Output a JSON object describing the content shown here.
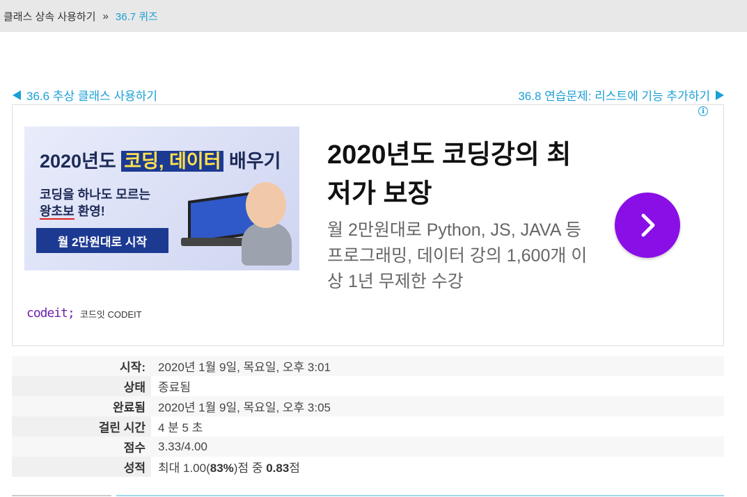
{
  "breadcrumb": {
    "root": "클래스 상속 사용하기",
    "separator": "»",
    "current": "36.7 퀴즈"
  },
  "nav": {
    "prev_label": "36.6 추상 클래스 사용하기",
    "next_label": "36.8 연습문제: 리스트에 기능 추가하기"
  },
  "ad": {
    "info_icon": "i",
    "image": {
      "title_prefix": "2020년도",
      "title_highlight": "코딩, 데이터",
      "title_suffix": "배우기",
      "line1": "코딩을 하나도 모르는",
      "line2_em": "왕초보",
      "line2_rest": " 환영!",
      "button": "월 2만원대로 시작"
    },
    "brand_logo": "codeit;",
    "brand_name": "코드잇 CODEIT",
    "headline": "2020년도 코딩강의 최저가 보장",
    "description": "월 2만원대로 Python, JS, JAVA 등 프로그래밍, 데이터 강의 1,600개 이상 1년 무제한 수강",
    "cta_color": "#8a0fe6"
  },
  "summary": {
    "rows": [
      {
        "label": "시작:",
        "value": "2020년 1월 9일, 목요일, 오후 3:01"
      },
      {
        "label": "상태",
        "value": "종료됨"
      },
      {
        "label": "완료됨",
        "value": "2020년 1월 9일, 목요일, 오후 3:05"
      },
      {
        "label": "걸린 시간",
        "value": "4 분 5 초"
      },
      {
        "label": "점수",
        "value": "3.33/4.00"
      }
    ],
    "grade": {
      "label": "성적",
      "prefix": "최대 1.00(",
      "percent": "83%",
      "middle": ")점 중 ",
      "score": "0.83",
      "suffix": "점"
    }
  },
  "colors": {
    "link": "#1a9fd6",
    "breadcrumb_bg": "#e8e8e8"
  }
}
